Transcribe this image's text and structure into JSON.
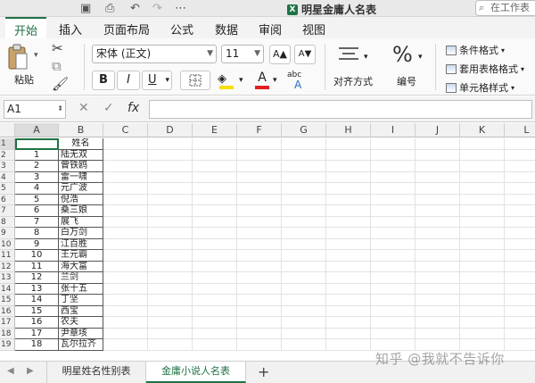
{
  "window": {
    "doc_title": "明星金庸人名表",
    "excel_badge": "X",
    "search_placeholder": "在工作表",
    "icons": [
      "save-icon",
      "print-icon",
      "undo-icon",
      "redo-icon",
      "more-icon",
      "search-icon"
    ]
  },
  "tabs": [
    {
      "label": "开始",
      "active": true
    },
    {
      "label": "插入"
    },
    {
      "label": "页面布局"
    },
    {
      "label": "公式"
    },
    {
      "label": "数据"
    },
    {
      "label": "审阅"
    },
    {
      "label": "视图"
    }
  ],
  "ribbon": {
    "paste_label": "粘贴",
    "font_name": "宋体 (正文)",
    "font_size": "11",
    "grow_font": "A▲",
    "shrink_font": "A▼",
    "bold": "B",
    "italic": "I",
    "underline": "U",
    "align_label": "对齐方式",
    "number_label": "编号",
    "number_glyph": "%",
    "conditional_format": "条件格式",
    "format_as_table": "套用表格格式",
    "cell_styles": "单元格样式",
    "text_wrap_glyph": "abc"
  },
  "formula_bar": {
    "name_box": "A1",
    "fx": "fx",
    "formula": ""
  },
  "grid": {
    "columns": [
      "A",
      "B",
      "C",
      "D",
      "E",
      "F",
      "G",
      "H",
      "I",
      "J",
      "K",
      "L"
    ],
    "selected_cell": "A1",
    "header_b": "姓名",
    "rows": [
      {
        "row": "1",
        "a": "",
        "b": "姓名"
      },
      {
        "row": "2",
        "a": "1",
        "b": "陆无双"
      },
      {
        "row": "3",
        "a": "2",
        "b": "曾铁鸥"
      },
      {
        "row": "4",
        "a": "3",
        "b": "雷一啸"
      },
      {
        "row": "5",
        "a": "4",
        "b": "元广波"
      },
      {
        "row": "6",
        "a": "5",
        "b": "倪浩"
      },
      {
        "row": "7",
        "a": "6",
        "b": "桑三娘"
      },
      {
        "row": "8",
        "a": "7",
        "b": "展飞"
      },
      {
        "row": "9",
        "a": "8",
        "b": "白万剑"
      },
      {
        "row": "10",
        "a": "9",
        "b": "江百胜"
      },
      {
        "row": "11",
        "a": "10",
        "b": "王元霸"
      },
      {
        "row": "12",
        "a": "11",
        "b": "海大富"
      },
      {
        "row": "13",
        "a": "12",
        "b": "兰剑"
      },
      {
        "row": "14",
        "a": "13",
        "b": "张十五"
      },
      {
        "row": "15",
        "a": "14",
        "b": "丁坚"
      },
      {
        "row": "16",
        "a": "15",
        "b": "西宝"
      },
      {
        "row": "17",
        "a": "16",
        "b": "农夫"
      },
      {
        "row": "18",
        "a": "17",
        "b": "尹章垓"
      },
      {
        "row": "19",
        "a": "18",
        "b": "瓦尔拉齐"
      }
    ]
  },
  "sheets": [
    {
      "label": "明星姓名性别表",
      "active": false
    },
    {
      "label": "金庸小说人名表",
      "active": true
    }
  ],
  "add_sheet": "+",
  "watermark": "知乎 @我就不告诉你",
  "colors": {
    "accent": "#1f7244",
    "font_color_swatch": "#e02020",
    "fill_color_swatch": "#f5e000"
  }
}
